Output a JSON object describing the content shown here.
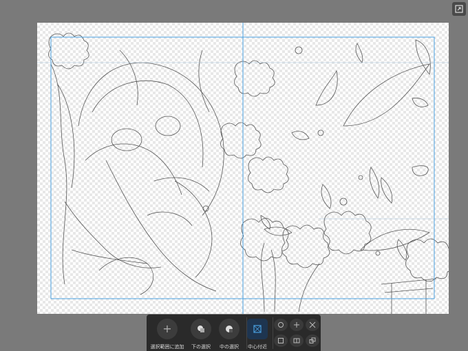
{
  "window": {
    "corner_button_icon": "expand-icon"
  },
  "toolbar": {
    "add_to_selection": "選択範囲に追加",
    "select_below": "下の選択",
    "select_middle": "中の選択",
    "center_vicinity": "中心付近"
  },
  "colors": {
    "background": "#7a7a7a",
    "toolbar": "#2a2a2a",
    "guide": "#4aa0e0",
    "accent": "#4aa0e0"
  }
}
